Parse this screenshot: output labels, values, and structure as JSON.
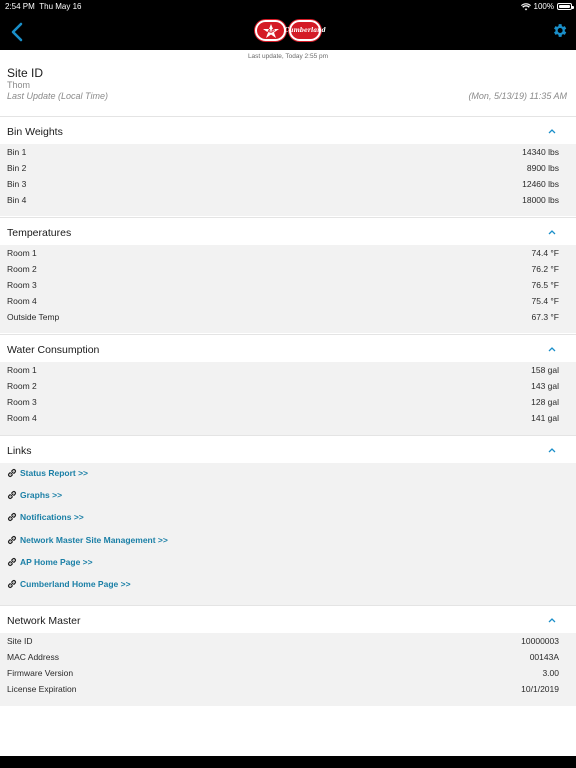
{
  "status_bar": {
    "time": "2:54 PM",
    "date": "Thu May 16",
    "battery": "100%"
  },
  "nav": {
    "back_icon": "chevron-left-icon",
    "settings_icon": "gear-icon",
    "logo_left": "AP",
    "logo_right": "Cumberland"
  },
  "header": {
    "last_update_note": "Last update, Today 2:55 pm",
    "site_id_label": "Site ID",
    "site_name": "Thom",
    "last_update_label": "Last Update (Local Time)",
    "last_update_value": "(Mon, 5/13/19) 11:35 AM"
  },
  "sections": {
    "bin_weights": {
      "title": "Bin Weights",
      "rows": [
        {
          "label": "Bin 1",
          "value": "14340 lbs"
        },
        {
          "label": "Bin 2",
          "value": "8900 lbs"
        },
        {
          "label": "Bin 3",
          "value": "12460 lbs"
        },
        {
          "label": "Bin 4",
          "value": "18000 lbs"
        }
      ]
    },
    "temperatures": {
      "title": "Temperatures",
      "rows": [
        {
          "label": "Room 1",
          "value": "74.4 °F"
        },
        {
          "label": "Room 2",
          "value": "76.2 °F"
        },
        {
          "label": "Room 3",
          "value": "76.5 °F"
        },
        {
          "label": "Room 4",
          "value": "75.4 °F"
        },
        {
          "label": "Outside Temp",
          "value": "67.3 °F"
        }
      ]
    },
    "water": {
      "title": "Water Consumption",
      "rows": [
        {
          "label": "Room 1",
          "value": "158 gal"
        },
        {
          "label": "Room 2",
          "value": "143 gal"
        },
        {
          "label": "Room 3",
          "value": "128 gal"
        },
        {
          "label": "Room 4",
          "value": "141 gal"
        }
      ]
    },
    "links": {
      "title": "Links",
      "items": [
        "Status Report >>",
        "Graphs >>",
        "Notifications >>",
        "Network Master Site Management >>",
        "AP Home Page >>",
        "Cumberland Home Page >>"
      ]
    },
    "network_master": {
      "title": "Network Master",
      "rows": [
        {
          "label": "Site ID",
          "value": "10000003"
        },
        {
          "label": "MAC Address",
          "value": "00143A"
        },
        {
          "label": "Firmware Version",
          "value": "3.00"
        },
        {
          "label": "License Expiration",
          "value": "10/1/2019"
        }
      ]
    }
  },
  "colors": {
    "link": "#1a7fa6",
    "accent": "#1a8fc9",
    "section_bg": "#f2f2f2"
  }
}
